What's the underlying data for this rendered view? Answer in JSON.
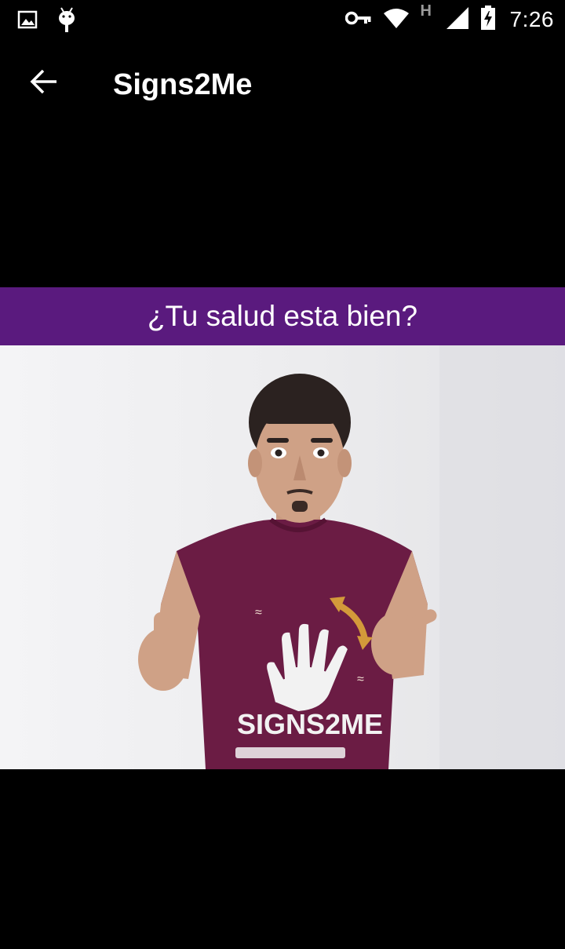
{
  "status_bar": {
    "time": "7:26",
    "network_letter": "H",
    "left_icons": [
      "image-icon",
      "android-debug-icon"
    ],
    "right_icons": [
      "vpn-key-icon",
      "wifi-icon",
      "signal-icon",
      "battery-charging-icon"
    ]
  },
  "toolbar": {
    "title": "Signs2Me",
    "back_icon": "arrow-back-icon"
  },
  "phrase": {
    "text": "¿Tu salud esta bien?",
    "background_color": "#5a1a7e"
  },
  "video": {
    "shirt_text": "SIGNS2ME",
    "shirt_color": "#6b1c44"
  }
}
